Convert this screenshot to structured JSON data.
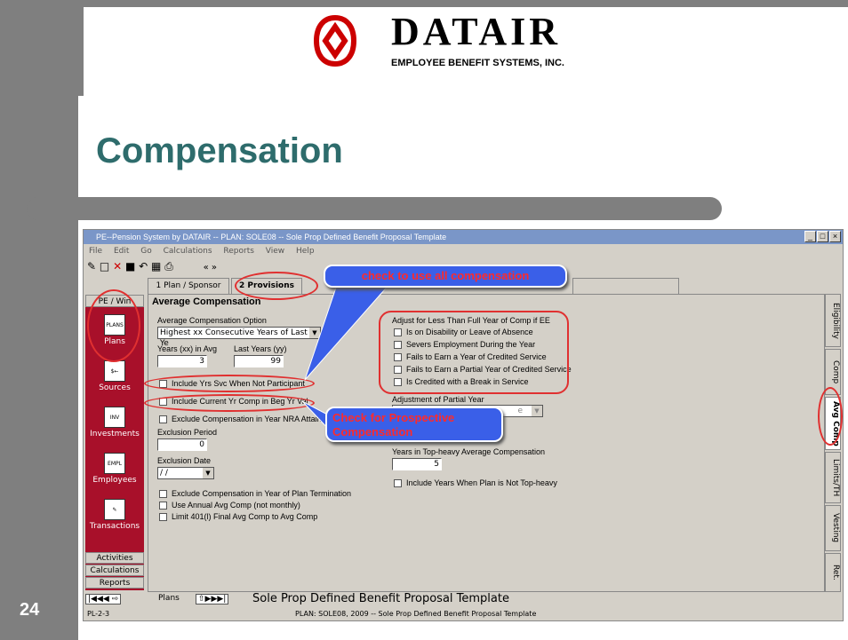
{
  "slide": {
    "title": "Compensation",
    "page_number": "24"
  },
  "logo": {
    "wordmark": "DATAIR",
    "subtitle": "EMPLOYEE BENEFIT SYSTEMS, INC."
  },
  "window": {
    "title": "PE--Pension System by DATAIR -- PLAN: SOLE08 -- Sole Prop Defined Benefit Proposal Template",
    "controls": [
      "_",
      "□",
      "×"
    ],
    "menu": [
      "File",
      "Edit",
      "Go",
      "Calculations",
      "Reports",
      "View",
      "Help"
    ],
    "toolbar_nav": "«  »",
    "tabs": [
      "1 Plan / Sponsor",
      "2 Provisions"
    ],
    "nav_header": "PE / Win",
    "nav": [
      {
        "label": "Plans",
        "icon": "plans-icon"
      },
      {
        "label": "Sources",
        "icon": "sources-icon"
      },
      {
        "label": "Investments",
        "icon": "investments-icon"
      },
      {
        "label": "Employees",
        "icon": "employees-icon"
      },
      {
        "label": "Transactions",
        "icon": "transactions-icon"
      }
    ],
    "nav_bottom": [
      "Activities",
      "Calculations",
      "Reports"
    ],
    "right_tabs": [
      "Eligibility",
      "Comp",
      "Avg Comp",
      "Limits/TH",
      "Vesting",
      "Ret."
    ]
  },
  "form": {
    "section_title": "Average Compensation",
    "avg_option_label": "Average Compensation Option",
    "avg_option_value": "Highest xx Consecutive Years of Last yy Ye",
    "years_in_avg_label": "Years (xx) in Avg",
    "years_in_avg_value": "3",
    "last_years_label": "Last Years (yy)",
    "last_years_value": "99",
    "include_yrs_svc": "Include Yrs Svc When Not Participant",
    "include_current_yr": "Include Current Yr Comp in Beg Yr Val",
    "exclude_nra": "Exclude Compensation in Year NRA Attain",
    "exclusion_period_label": "Exclusion Period",
    "exclusion_period_value": "0",
    "exclusion_date_label": "Exclusion Date",
    "exclusion_date_value": "/ /",
    "exclude_termination": "Exclude Compensation in Year of Plan Termination",
    "use_annual": "Use Annual Avg Comp (not monthly)",
    "limit_401": "Limit 401(l) Final Avg Comp to Avg Comp",
    "adjust_label": "Adjust for Less Than Full Year of Comp if EE",
    "adjust_items": [
      "Is on Disability or Leave of Absence",
      "Severs Employment During the Year",
      "Fails to Earn a Year of Credited Service",
      "Fails to Earn a Partial Year of Credited Service",
      "Is Credited with a Break in Service"
    ],
    "adjustment_partial_label": "Adjustment of Partial Year",
    "adjustment_partial_value": "e",
    "top_heavy_label": "Years in Top-heavy Average Compensation",
    "top_heavy_value": "5",
    "include_not_topheavy": "Include Years When Plan is Not Top-heavy"
  },
  "status": {
    "nav_label": "Plans",
    "record_title": "Sole Prop Defined Benefit Proposal Template",
    "code": "PL-2-3",
    "plan_line": "PLAN: SOLE08,  2009 -- Sole Prop Defined Benefit Proposal Template"
  },
  "callouts": {
    "all_comp": "check to use all compensation",
    "prospective_1": "Check for Prospective",
    "prospective_2": "Compensation"
  },
  "colors": {
    "title": "#2e6c6c",
    "nav_bg": "#a8102a",
    "callout_bg": "#3a5fe8",
    "callout_text": "#ff2a2a",
    "ring": "#e03030"
  }
}
